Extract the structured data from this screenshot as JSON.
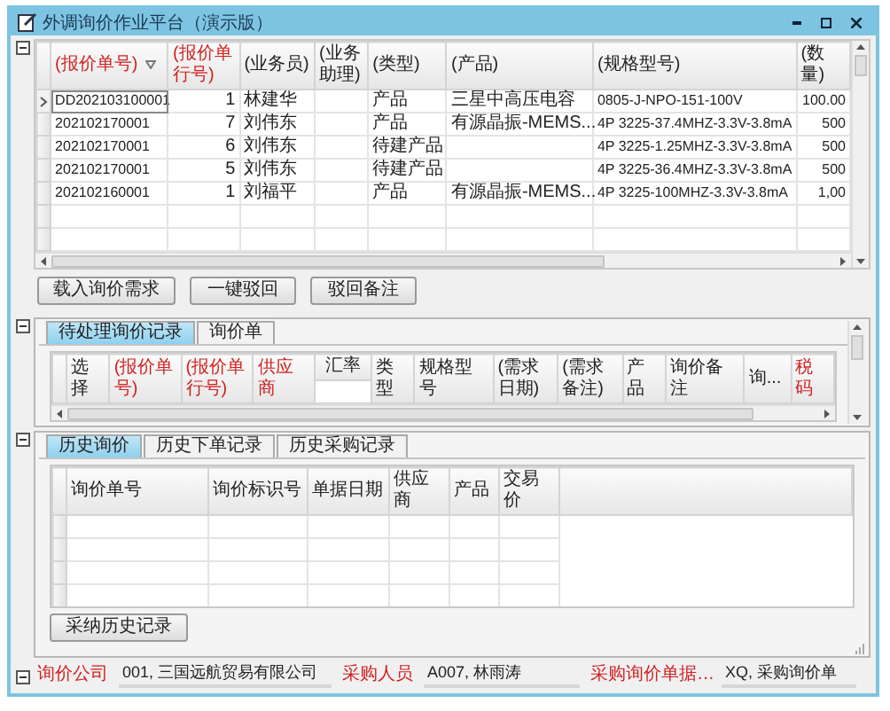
{
  "window": {
    "title": "外调询价作业平台（演示版）"
  },
  "quote_grid": {
    "columns": [
      {
        "label": "(报价单号)",
        "required": true,
        "sorted": true
      },
      {
        "label": "(报价单行号)",
        "required": true,
        "sorted": false
      },
      {
        "label": "(业务员)",
        "required": false,
        "sorted": false
      },
      {
        "label": "(业务助理)",
        "required": false,
        "sorted": false
      },
      {
        "label": "(类型)",
        "required": false,
        "sorted": false
      },
      {
        "label": "(产品)",
        "required": false,
        "sorted": false
      },
      {
        "label": "(规格型号)",
        "required": false,
        "sorted": false
      },
      {
        "label": "(数量)",
        "required": false,
        "sorted": false
      }
    ],
    "rows": [
      {
        "selected": true,
        "cells": [
          "DD202103100001",
          "1",
          "林建华",
          null,
          "产品",
          "三星中高压电容",
          "0805-J-NPO-151-100V",
          "100.00"
        ]
      },
      {
        "selected": false,
        "cells": [
          "202102170001",
          "7",
          "刘伟东",
          null,
          "产品",
          "有源晶振-MEMS...",
          "4P 3225-37.4MHZ-3.3V-3.8mA",
          "500"
        ]
      },
      {
        "selected": false,
        "cells": [
          "202102170001",
          "6",
          "刘伟东",
          null,
          "待建产品",
          null,
          "4P 3225-1.25MHZ-3.3V-3.8mA",
          "500"
        ]
      },
      {
        "selected": false,
        "cells": [
          "202102170001",
          "5",
          "刘伟东",
          null,
          "待建产品",
          null,
          "4P 3225-36.4MHZ-3.3V-3.8mA",
          "500"
        ]
      },
      {
        "selected": false,
        "cells": [
          "202102160001",
          "1",
          "刘福平",
          null,
          "产品",
          "有源晶振-MEMS...",
          "4P 3225-100MHZ-3.3V-3.8mA",
          "1,00"
        ]
      }
    ]
  },
  "actions": [
    "载入询价需求",
    "一键驳回",
    "驳回备注"
  ],
  "pending_panel": {
    "tabs": [
      {
        "label": "待处理询价记录",
        "selected": true
      },
      {
        "label": "询价单",
        "selected": false
      }
    ],
    "columns": [
      {
        "label": "选择",
        "required": false
      },
      {
        "label": "(报价单号)",
        "required": true
      },
      {
        "label": "(报价单行号)",
        "required": true
      },
      {
        "label": "供应商",
        "required": true
      },
      {
        "label": "汇率",
        "required": false
      },
      {
        "label": "类型",
        "required": false
      },
      {
        "label": "规格型号",
        "required": false
      },
      {
        "label": "(需求日期)",
        "required": false
      },
      {
        "label": "(需求备注)",
        "required": false
      },
      {
        "label": "产品",
        "required": false
      },
      {
        "label": "询价备注",
        "required": false
      },
      {
        "label": "询...",
        "required": false
      },
      {
        "label": "税码",
        "required": true
      }
    ]
  },
  "history_panel": {
    "tabs": [
      {
        "label": "历史询价",
        "selected": true
      },
      {
        "label": "历史下单记录",
        "selected": false
      },
      {
        "label": "历史采购记录",
        "selected": false
      }
    ],
    "columns": [
      "询价单号",
      "询价标识号",
      "单据日期",
      "供应商",
      "产品",
      "交易价"
    ],
    "button": "采纳历史记录"
  },
  "footer": [
    {
      "label": "询价公司",
      "value": "001, 三国远航贸易有限公司"
    },
    {
      "label": "采购人员",
      "value": "A007, 林雨涛"
    },
    {
      "label": "采购询价单据…",
      "value": "XQ, 采购询价单"
    }
  ]
}
